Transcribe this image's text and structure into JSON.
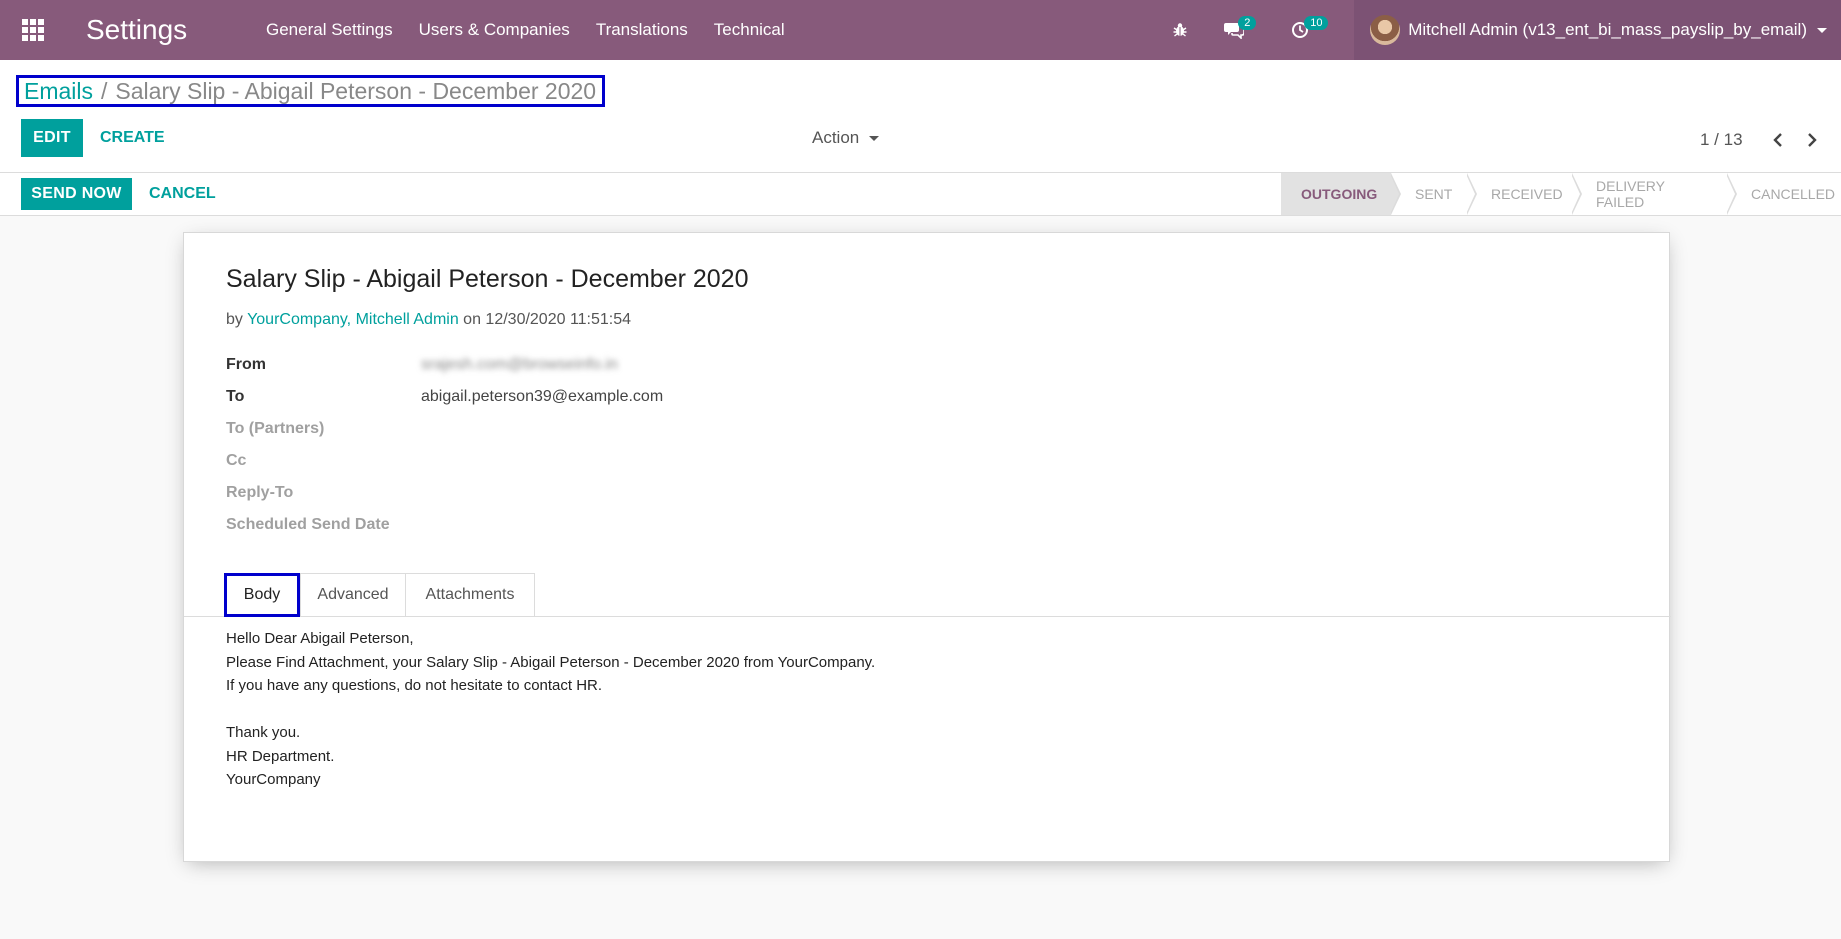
{
  "navbar": {
    "app_name": "Settings",
    "menu": [
      "General Settings",
      "Users & Companies",
      "Translations",
      "Technical"
    ],
    "messages_count": "2",
    "activities_count": "10",
    "user": "Mitchell Admin (v13_ent_bi_mass_payslip_by_email)"
  },
  "breadcrumb": {
    "parent": "Emails",
    "separator": "/",
    "current": "Salary Slip - Abigail Peterson - December 2020"
  },
  "toolbar": {
    "edit_label": "EDIT",
    "create_label": "CREATE",
    "action_label": "Action",
    "pager": "1 / 13"
  },
  "statusbar": {
    "send_label": "SEND NOW",
    "cancel_label": "CANCEL",
    "stages": [
      "OUTGOING",
      "SENT",
      "RECEIVED",
      "DELIVERY FAILED",
      "CANCELLED"
    ],
    "active_stage": "OUTGOING"
  },
  "mail": {
    "subject": "Salary Slip - Abigail Peterson - December 2020",
    "by_prefix": "by",
    "authors": "YourCompany, Mitchell Admin",
    "on_prefix": "on",
    "date": "12/30/2020 11:51:54",
    "fields": {
      "from_label": "From",
      "from_value": "srajesh.com@browseinfo.in",
      "to_label": "To",
      "to_value": "abigail.peterson39@example.com",
      "to_partners_label": "To (Partners)",
      "cc_label": "Cc",
      "reply_to_label": "Reply-To",
      "scheduled_label": "Scheduled Send Date"
    },
    "tabs": [
      "Body",
      "Advanced",
      "Attachments"
    ],
    "body_lines": [
      "Hello Dear Abigail Peterson,",
      "Please Find Attachment, your Salary Slip - Abigail Peterson - December 2020 from YourCompany.",
      "If you have any questions, do not hesitate to contact HR.",
      "Thank you.",
      "HR Department.",
      "YourCompany"
    ]
  },
  "colors": {
    "navbar": "#875a7b",
    "accent": "#00a09d",
    "highlight_box": "#0000cc"
  }
}
